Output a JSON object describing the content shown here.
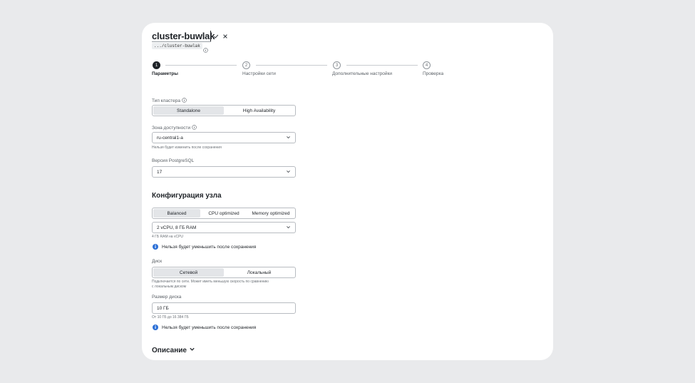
{
  "header": {
    "title": "cluster-buwlak",
    "path": ".../cluster-buwlak",
    "confirm_icon": "check-icon",
    "cancel_icon": "close-icon"
  },
  "stepper": {
    "steps": [
      {
        "number": "1",
        "label": "Параметры",
        "active": true
      },
      {
        "number": "2",
        "label": "Настройки сети",
        "active": false
      },
      {
        "number": "3",
        "label": "Дополнительные настройки",
        "active": false
      },
      {
        "number": "4",
        "label": "Проверка",
        "active": false
      }
    ]
  },
  "cluster_type": {
    "label": "Тип кластера",
    "options": [
      "Standalone",
      "High Availability"
    ],
    "selected": "Standalone"
  },
  "zone": {
    "label": "Зона доступности",
    "value": "ru-central1-a",
    "hint": "Нельзя будет изменить после сохранения"
  },
  "pg_version": {
    "label": "Версия PostgreSQL",
    "value": "17"
  },
  "node_config": {
    "heading": "Конфигурация узла",
    "options": [
      "Balanced",
      "CPU optimized",
      "Memory optimized"
    ],
    "selected": "Balanced",
    "preset": "2 vCPU, 8 ГБ RAM",
    "preset_hint": "4 ГБ RAM на vCPU",
    "note": "Нельзя будет уменьшить после сохранения"
  },
  "disk": {
    "label": "Диск",
    "options": [
      "Сетевой",
      "Локальный"
    ],
    "selected": "Сетевой",
    "hint_line1": "Подключается по сети. Может иметь меньшую скорость по сравнению",
    "hint_line2": "с локальным диском",
    "size_label": "Размер диска",
    "size_value": "10 ГБ",
    "size_hint": "От 10 ГБ до 16 384 ГБ",
    "note": "Нельзя будет уменьшить после сохранения"
  },
  "description": {
    "heading": "Описание"
  },
  "colors": {
    "background": "#e9eaec",
    "card": "#ffffff",
    "accent_info": "#2b6fd6",
    "active_step": "#1f2328"
  }
}
